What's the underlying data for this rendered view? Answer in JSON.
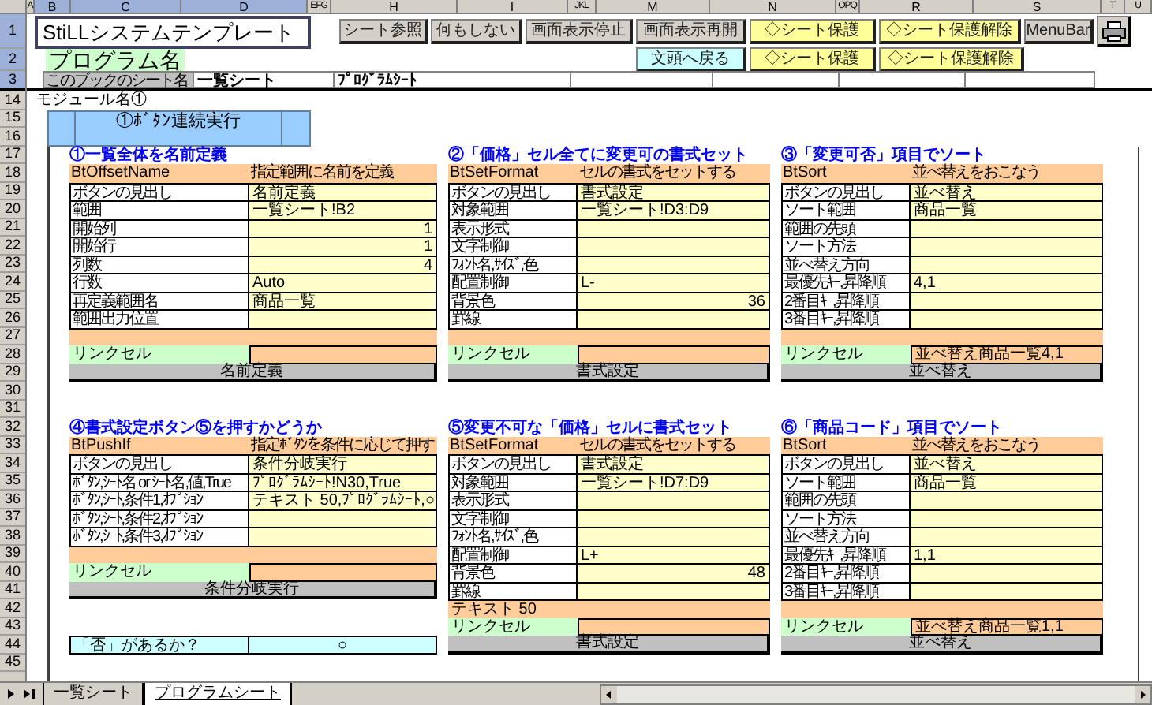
{
  "columns": [
    "A",
    "B",
    "C",
    "D",
    "EFG",
    "H",
    "I",
    "JKL",
    "M",
    "N",
    "OPQ",
    "R",
    "S",
    "T",
    "U"
  ],
  "row_numbers": [
    "1",
    "2",
    "3",
    "14",
    "15",
    "16",
    "17",
    "18",
    "19",
    "20",
    "21",
    "22",
    "23",
    "24",
    "25",
    "26",
    "27",
    "28",
    "29",
    "30",
    "31",
    "32",
    "33",
    "34",
    "35",
    "36",
    "37",
    "38",
    "39",
    "40",
    "41",
    "42",
    "43",
    "44",
    "45"
  ],
  "title": "StiLLシステムテンプレート",
  "row1_buttons": [
    {
      "label": "シート参照",
      "kind": "gray"
    },
    {
      "label": "何もしない",
      "kind": "gray"
    },
    {
      "label": "画面表示停止",
      "kind": "gray"
    },
    {
      "label": "画面表示再開",
      "kind": "gray"
    },
    {
      "label": "◇シート保護",
      "kind": "yellow"
    },
    {
      "label": "◇シート保護解除",
      "kind": "yellow"
    },
    {
      "label": "MenuBar",
      "kind": "gray"
    }
  ],
  "program_label": "プログラム名",
  "row2_buttons": [
    {
      "label": "文頭へ戻る",
      "kind": "cyan"
    },
    {
      "label": "◇シート保護",
      "kind": "yellow"
    },
    {
      "label": "◇シート保護解除",
      "kind": "yellow"
    }
  ],
  "sheet_names": {
    "label": "このブックのシート名",
    "values": [
      "一覧シート",
      "ﾌﾟﾛｸﾞﾗﾑｼｰﾄ"
    ]
  },
  "module_label": "モジュール名①",
  "module_title": "①ﾎﾞﾀﾝ連続実行",
  "blocks_top": [
    {
      "title": "①一覧全体を名前定義",
      "class_name": "BtOffsetName",
      "description": "指定範囲に名前を定義",
      "params": [
        {
          "label": "ボタンの見出し",
          "value": "名前定義",
          "kind": "text"
        },
        {
          "label": "範囲",
          "value": "一覧シート!B2",
          "kind": "text"
        },
        {
          "label": "開始列",
          "value": "1",
          "kind": "number"
        },
        {
          "label": "開始行",
          "value": "1",
          "kind": "number"
        },
        {
          "label": "列数",
          "value": "4",
          "kind": "number"
        },
        {
          "label": "行数",
          "value": "Auto",
          "kind": "text"
        },
        {
          "label": "再定義範囲名",
          "value": "商品一覧",
          "kind": "text"
        },
        {
          "label": "範囲出力位置",
          "kind": "text"
        }
      ],
      "link_label": "リンクセル",
      "button": "名前定義"
    },
    {
      "title": "②「価格」セル全てに変更可の書式セット",
      "class_name": "BtSetFormat",
      "description": "セルの書式をセットする",
      "params": [
        {
          "label": "ボタンの見出し",
          "value": "書式設定",
          "kind": "text"
        },
        {
          "label": "対象範囲",
          "value": "一覧シート!D3:D9",
          "kind": "text"
        },
        {
          "label": "表示形式",
          "kind": "text"
        },
        {
          "label": "文字制御",
          "kind": "text"
        },
        {
          "label": "ﾌｫﾝﾄ名,ｻｲｽﾞ,色",
          "kind": "text"
        },
        {
          "label": "配置制御",
          "value": "L-",
          "kind": "text"
        },
        {
          "label": "背景色",
          "value": "36",
          "kind": "number"
        },
        {
          "label": "罫線",
          "kind": "text"
        }
      ],
      "link_label": "リンクセル",
      "button": "書式設定"
    },
    {
      "title": "③「変更可否」項目でソート",
      "class_name": "BtSort",
      "description": "並べ替えをおこなう",
      "params": [
        {
          "label": "ボタンの見出し",
          "value": "並べ替え",
          "kind": "text"
        },
        {
          "label": "ソート範囲",
          "value": "商品一覧",
          "kind": "text"
        },
        {
          "label": "範囲の先頭",
          "kind": "text"
        },
        {
          "label": "ソート方法",
          "kind": "text"
        },
        {
          "label": "並べ替え方向",
          "kind": "text"
        },
        {
          "label": "最優先ｷｰ,昇降順",
          "value": "4,1",
          "kind": "text"
        },
        {
          "label": "2番目ｷｰ,昇降順",
          "kind": "text"
        },
        {
          "label": "3番目ｷｰ,昇降順",
          "kind": "text"
        }
      ],
      "link_label": "リンクセル",
      "link_value": "並べ替え商品一覧4,1",
      "button": "並べ替え"
    }
  ],
  "blocks_bottom": [
    {
      "title": "④書式設定ボタン⑤を押すかどうか",
      "class_name": "BtPushIf",
      "description": "指定ﾎﾞﾀﾝを条件に応じて押す",
      "params": [
        {
          "label": "ボタンの見出し",
          "value": "条件分岐実行",
          "kind": "text"
        },
        {
          "label": "ﾎﾞﾀﾝ,ｼｰﾄ名 or ｼｰﾄ名,値,True",
          "value": "ﾌﾟﾛｸﾞﾗﾑｼｰﾄ!N30,True",
          "kind": "text"
        },
        {
          "label": "ﾎﾞﾀﾝ,ｼｰﾄ,条件1,ｵﾌﾟｼｮﾝ",
          "value": "テキスト 50,ﾌﾟﾛｸﾞﾗﾑｼｰﾄ,○",
          "kind": "text"
        },
        {
          "label": "ﾎﾞﾀﾝ,ｼｰﾄ,条件2,ｵﾌﾟｼｮﾝ",
          "kind": "text"
        },
        {
          "label": "ﾎﾞﾀﾝ,ｼｰﾄ,条件3,ｵﾌﾟｼｮﾝ",
          "kind": "text"
        }
      ],
      "link_label": "リンクセル",
      "button": "条件分岐実行",
      "footer": {
        "label": "「否」があるか？",
        "value": "○"
      }
    },
    {
      "title": "⑤変更不可な「価格」セルに書式セット",
      "class_name": "BtSetFormat",
      "description": "セルの書式をセットする",
      "params": [
        {
          "label": "ボタンの見出し",
          "value": "書式設定",
          "kind": "text"
        },
        {
          "label": "対象範囲",
          "value": "一覧シート!D7:D9",
          "kind": "text"
        },
        {
          "label": "表示形式",
          "kind": "text"
        },
        {
          "label": "文字制御",
          "kind": "text"
        },
        {
          "label": "ﾌｫﾝﾄ名,ｻｲｽﾞ,色",
          "kind": "text"
        },
        {
          "label": "配置制御",
          "value": "L+",
          "kind": "text"
        },
        {
          "label": "背景色",
          "value": "48",
          "kind": "number"
        },
        {
          "label": "罫線",
          "kind": "text"
        }
      ],
      "note": "テキスト 50",
      "link_label": "リンクセル",
      "button": "書式設定"
    },
    {
      "title": "⑥「商品コード」項目でソート",
      "class_name": "BtSort",
      "description": "並べ替えをおこなう",
      "params": [
        {
          "label": "ボタンの見出し",
          "value": "並べ替え",
          "kind": "text"
        },
        {
          "label": "ソート範囲",
          "value": "商品一覧",
          "kind": "text"
        },
        {
          "label": "範囲の先頭",
          "kind": "text"
        },
        {
          "label": "ソート方法",
          "kind": "text"
        },
        {
          "label": "並べ替え方向",
          "kind": "text"
        },
        {
          "label": "最優先ｷｰ,昇降順",
          "value": "1,1",
          "kind": "text"
        },
        {
          "label": "2番目ｷｰ,昇降順",
          "kind": "text"
        },
        {
          "label": "3番目ｷｰ,昇降順",
          "kind": "text"
        }
      ],
      "link_label": "リンクセル",
      "link_value": "並べ替え商品一覧1,1",
      "button": "並べ替え"
    }
  ],
  "sheet_tabs": [
    {
      "label": "一覧シート",
      "selected": false
    },
    {
      "label": "プログラムシート",
      "selected": true
    }
  ]
}
